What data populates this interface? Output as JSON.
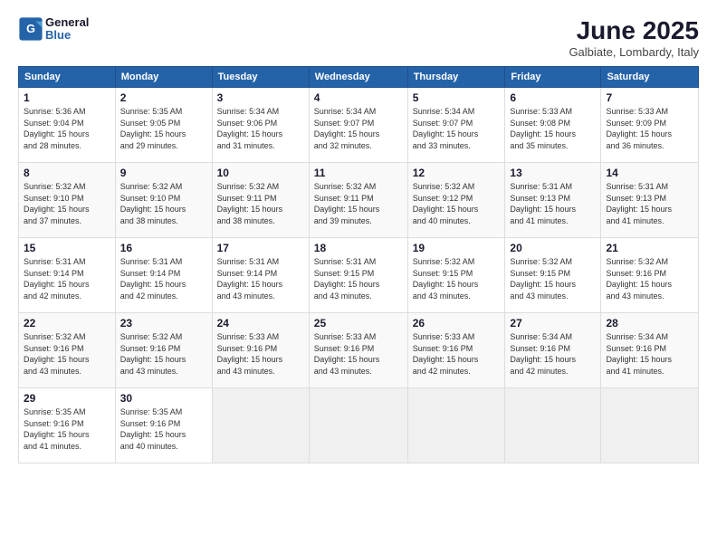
{
  "logo": {
    "line1": "General",
    "line2": "Blue"
  },
  "title": "June 2025",
  "subtitle": "Galbiate, Lombardy, Italy",
  "weekdays": [
    "Sunday",
    "Monday",
    "Tuesday",
    "Wednesday",
    "Thursday",
    "Friday",
    "Saturday"
  ],
  "weeks": [
    [
      {
        "day": "1",
        "sunrise": "5:36 AM",
        "sunset": "9:04 PM",
        "daylight": "15 hours and 28 minutes."
      },
      {
        "day": "2",
        "sunrise": "5:35 AM",
        "sunset": "9:05 PM",
        "daylight": "15 hours and 29 minutes."
      },
      {
        "day": "3",
        "sunrise": "5:34 AM",
        "sunset": "9:06 PM",
        "daylight": "15 hours and 31 minutes."
      },
      {
        "day": "4",
        "sunrise": "5:34 AM",
        "sunset": "9:07 PM",
        "daylight": "15 hours and 32 minutes."
      },
      {
        "day": "5",
        "sunrise": "5:34 AM",
        "sunset": "9:07 PM",
        "daylight": "15 hours and 33 minutes."
      },
      {
        "day": "6",
        "sunrise": "5:33 AM",
        "sunset": "9:08 PM",
        "daylight": "15 hours and 35 minutes."
      },
      {
        "day": "7",
        "sunrise": "5:33 AM",
        "sunset": "9:09 PM",
        "daylight": "15 hours and 36 minutes."
      }
    ],
    [
      {
        "day": "8",
        "sunrise": "5:32 AM",
        "sunset": "9:10 PM",
        "daylight": "15 hours and 37 minutes."
      },
      {
        "day": "9",
        "sunrise": "5:32 AM",
        "sunset": "9:10 PM",
        "daylight": "15 hours and 38 minutes."
      },
      {
        "day": "10",
        "sunrise": "5:32 AM",
        "sunset": "9:11 PM",
        "daylight": "15 hours and 38 minutes."
      },
      {
        "day": "11",
        "sunrise": "5:32 AM",
        "sunset": "9:11 PM",
        "daylight": "15 hours and 39 minutes."
      },
      {
        "day": "12",
        "sunrise": "5:32 AM",
        "sunset": "9:12 PM",
        "daylight": "15 hours and 40 minutes."
      },
      {
        "day": "13",
        "sunrise": "5:31 AM",
        "sunset": "9:13 PM",
        "daylight": "15 hours and 41 minutes."
      },
      {
        "day": "14",
        "sunrise": "5:31 AM",
        "sunset": "9:13 PM",
        "daylight": "15 hours and 41 minutes."
      }
    ],
    [
      {
        "day": "15",
        "sunrise": "5:31 AM",
        "sunset": "9:14 PM",
        "daylight": "15 hours and 42 minutes."
      },
      {
        "day": "16",
        "sunrise": "5:31 AM",
        "sunset": "9:14 PM",
        "daylight": "15 hours and 42 minutes."
      },
      {
        "day": "17",
        "sunrise": "5:31 AM",
        "sunset": "9:14 PM",
        "daylight": "15 hours and 43 minutes."
      },
      {
        "day": "18",
        "sunrise": "5:31 AM",
        "sunset": "9:15 PM",
        "daylight": "15 hours and 43 minutes."
      },
      {
        "day": "19",
        "sunrise": "5:32 AM",
        "sunset": "9:15 PM",
        "daylight": "15 hours and 43 minutes."
      },
      {
        "day": "20",
        "sunrise": "5:32 AM",
        "sunset": "9:15 PM",
        "daylight": "15 hours and 43 minutes."
      },
      {
        "day": "21",
        "sunrise": "5:32 AM",
        "sunset": "9:16 PM",
        "daylight": "15 hours and 43 minutes."
      }
    ],
    [
      {
        "day": "22",
        "sunrise": "5:32 AM",
        "sunset": "9:16 PM",
        "daylight": "15 hours and 43 minutes."
      },
      {
        "day": "23",
        "sunrise": "5:32 AM",
        "sunset": "9:16 PM",
        "daylight": "15 hours and 43 minutes."
      },
      {
        "day": "24",
        "sunrise": "5:33 AM",
        "sunset": "9:16 PM",
        "daylight": "15 hours and 43 minutes."
      },
      {
        "day": "25",
        "sunrise": "5:33 AM",
        "sunset": "9:16 PM",
        "daylight": "15 hours and 43 minutes."
      },
      {
        "day": "26",
        "sunrise": "5:33 AM",
        "sunset": "9:16 PM",
        "daylight": "15 hours and 42 minutes."
      },
      {
        "day": "27",
        "sunrise": "5:34 AM",
        "sunset": "9:16 PM",
        "daylight": "15 hours and 42 minutes."
      },
      {
        "day": "28",
        "sunrise": "5:34 AM",
        "sunset": "9:16 PM",
        "daylight": "15 hours and 41 minutes."
      }
    ],
    [
      {
        "day": "29",
        "sunrise": "5:35 AM",
        "sunset": "9:16 PM",
        "daylight": "15 hours and 41 minutes."
      },
      {
        "day": "30",
        "sunrise": "5:35 AM",
        "sunset": "9:16 PM",
        "daylight": "15 hours and 40 minutes."
      },
      null,
      null,
      null,
      null,
      null
    ]
  ]
}
